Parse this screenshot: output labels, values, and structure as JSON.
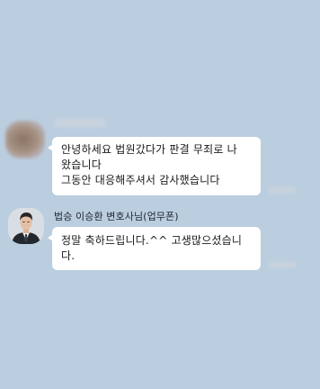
{
  "chat": {
    "messages": [
      {
        "sender": "",
        "lines": [
          "안녕하세요 법원갔다가 판결 무죄로 나",
          "왔습니다",
          "그동안 대응해주셔서 감사했습니다"
        ]
      },
      {
        "sender": "법승 이승환 변호사님(업무폰)",
        "lines": [
          "정말 축하드립니다.^^ 고생많으셨습니",
          "다."
        ]
      }
    ]
  },
  "colors": {
    "background": "#bacee0",
    "bubble": "#ffffff",
    "text": "#1a1a1a"
  }
}
